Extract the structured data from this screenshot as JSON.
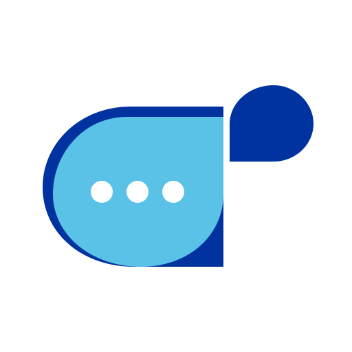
{
  "logo": {
    "icon": "chat-bubble-typing-icon",
    "colors": {
      "background": "#ffffff",
      "dark_blue": "#0033a0",
      "light_blue": "#5bc2e7",
      "dot": "#ffffff"
    },
    "typing_dots": 3
  }
}
